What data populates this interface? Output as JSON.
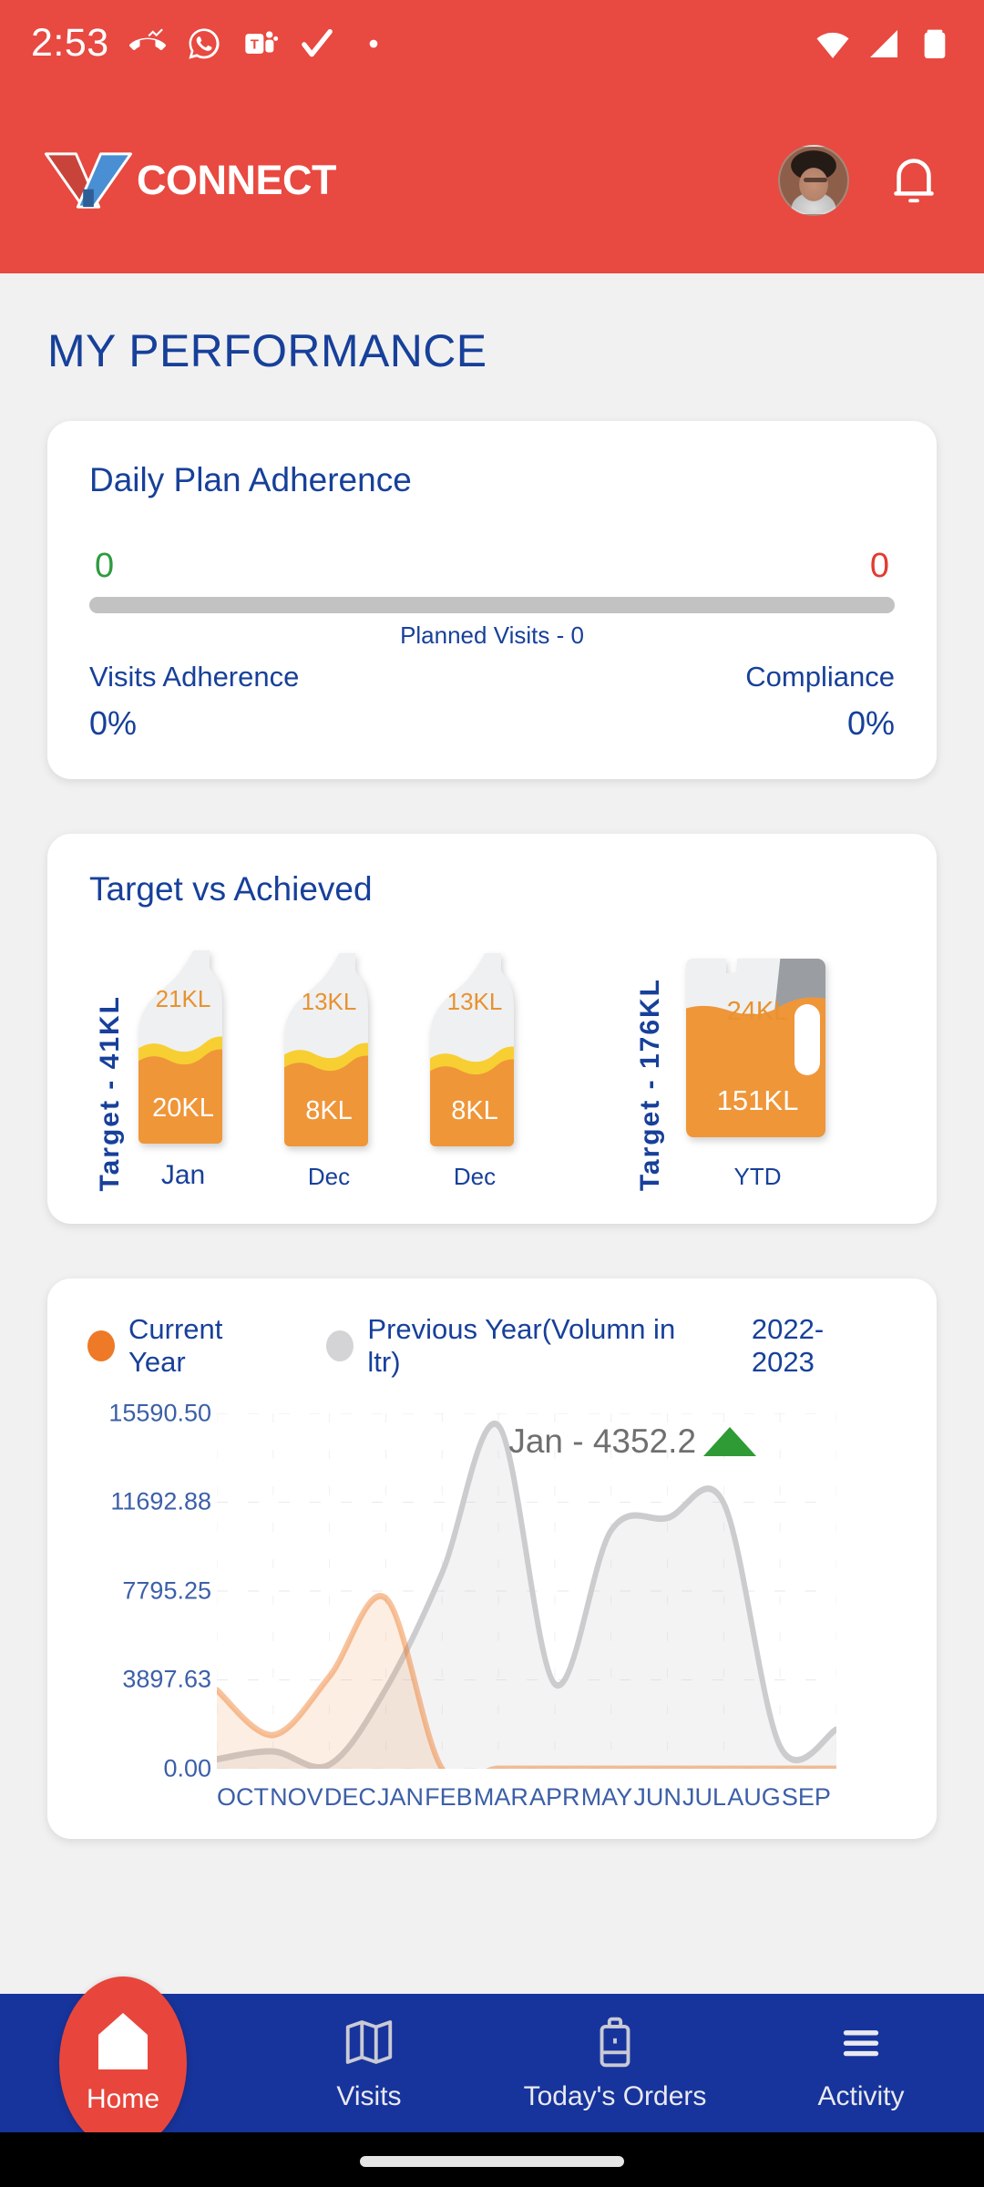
{
  "status_bar": {
    "clock": "2:53",
    "left_icons": [
      "missed-call-icon",
      "whatsapp-icon",
      "ms-teams-icon",
      "checkmark-icon",
      "dot-icon"
    ],
    "right_icons": [
      "wifi-icon",
      "cellular-signal-icon",
      "battery-icon"
    ]
  },
  "app_bar": {
    "logo_mark": "v-logo-icon",
    "logo_text": "CONNECT",
    "avatar": "user-avatar",
    "notification_icon": "bell-icon",
    "background_color": "#e84940"
  },
  "page_title": "MY PERFORMANCE",
  "adherence": {
    "title": "Daily Plan Adherence",
    "left_count": "0",
    "left_count_color": "#2e9b3e",
    "right_count": "0",
    "right_count_color": "#e23b30",
    "planned_visits": "Planned Visits - 0",
    "left_label": "Visits Adherence",
    "left_value": "0%",
    "right_label": "Compliance",
    "right_value": "0%"
  },
  "target_vs_achieved": {
    "title": "Target vs Achieved",
    "monthly_target": "Target - 41KL",
    "ytd_target": "Target - 176KL",
    "bottles": [
      {
        "remaining": "21KL",
        "achieved": "20KL",
        "caption": "Jan",
        "fill_ratio": 0.49
      },
      {
        "remaining": "13KL",
        "achieved": "8KL",
        "caption": "Dec",
        "fill_ratio": 0.46
      },
      {
        "remaining": "13KL",
        "achieved": "8KL",
        "caption": "Dec",
        "fill_ratio": 0.43
      }
    ],
    "ytd": {
      "remaining": "24KL",
      "achieved": "151KL",
      "caption": "YTD",
      "fill_ratio": 0.68
    },
    "fill_color": "#ef9639",
    "wave_color": "#f7cf33",
    "empty_color": "#eff0f2"
  },
  "chart_card": {
    "legend": [
      {
        "label": "Current Year",
        "color": "#ee7926"
      },
      {
        "label": "Previous Year(Volumn in ltr)",
        "color": "#d4d4d6"
      }
    ],
    "year_range": "2022-2023",
    "tooltip_text": "Jan - 4352.2",
    "tooltip_trend": "up-triangle-icon",
    "tooltip_trend_color": "#2e9b34"
  },
  "chart_data": {
    "type": "area",
    "title": "",
    "xlabel": "",
    "ylabel": "",
    "categories": [
      "OCT",
      "NOV",
      "DEC",
      "JAN",
      "FEB",
      "MAR",
      "APR",
      "MAY",
      "JUN",
      "JUL",
      "AUG",
      "SEP"
    ],
    "y_ticks": [
      "0.00",
      "3897.63",
      "7795.25",
      "11692.88",
      "15590.50"
    ],
    "y_tick_values": [
      0,
      3897.63,
      7795.25,
      11692.88,
      15590.5
    ],
    "ylim": [
      0,
      15590.5
    ],
    "grid": true,
    "legend_position": "top-left",
    "series": [
      {
        "name": "Current Year",
        "color": "#ee7926",
        "values": [
          3450,
          1480,
          4050,
          7480,
          0,
          0,
          0,
          0,
          0,
          0,
          0,
          0
        ]
      },
      {
        "name": "Previous Year(Volumn in ltr)",
        "color": "#c9c9cc",
        "values": [
          420,
          760,
          180,
          3500,
          8600,
          15050,
          3720,
          10450,
          11000,
          11650,
          980,
          1720
        ]
      }
    ],
    "annotations": [
      {
        "text": "Jan - 4352.2",
        "trend": "up"
      }
    ]
  },
  "bottom_nav": {
    "items": [
      {
        "label": "Home",
        "icon": "home-icon",
        "active": true
      },
      {
        "label": "Visits",
        "icon": "map-icon",
        "active": false
      },
      {
        "label": "Today's Orders",
        "icon": "briefcase-icon",
        "active": false
      },
      {
        "label": "Activity",
        "icon": "menu-icon",
        "active": false
      }
    ],
    "background_color": "#17349c",
    "active_color": "#e8463c"
  }
}
